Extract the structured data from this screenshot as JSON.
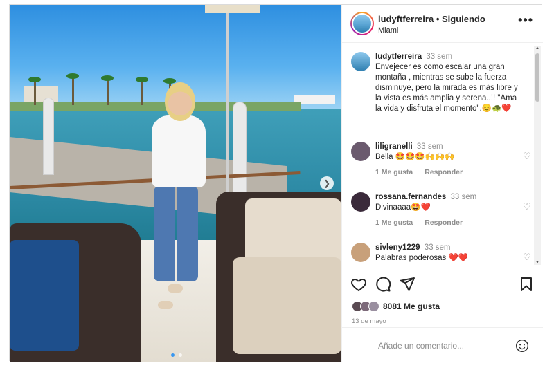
{
  "post": {
    "username": "ludyftferreira",
    "separator": "•",
    "follow_status": "Siguiendo",
    "location": "Miami",
    "more_icon": "more-horizontal-icon"
  },
  "caption": {
    "username": "ludytferreira",
    "time": "33 sem",
    "text": "Envejecer es como escalar una gran montaña , mientras se sube la fuerza disminuye, pero la mirada es más libre y la vista es más amplia y serena..!! \"Ama la vida y disfruta el momento\".😊🐢❤️"
  },
  "comments": [
    {
      "username": "liligranelli",
      "time": "33 sem",
      "text": "Bella 🤩🤩🤩🙌🙌🙌",
      "likes_label": "1 Me gusta",
      "reply_label": "Responder",
      "avatar_color": "#6b5a6e"
    },
    {
      "username": "rossana.fernandes",
      "time": "33 sem",
      "text": "Divinaaaa🤩❤️",
      "likes_label": "1 Me gusta",
      "reply_label": "Responder",
      "avatar_color": "#3a2a3a"
    },
    {
      "username": "sivleny1229",
      "time": "33 sem",
      "text": "Palabras poderosas ❤️❤️",
      "avatar_color": "#c8a07a"
    }
  ],
  "stats": {
    "likes": "8081 Me gusta",
    "date": "13 de mayo"
  },
  "composer": {
    "placeholder": "Añade un comentario..."
  },
  "colors": {
    "heart_red": "#ed4956",
    "muted": "#8e8e8e"
  }
}
